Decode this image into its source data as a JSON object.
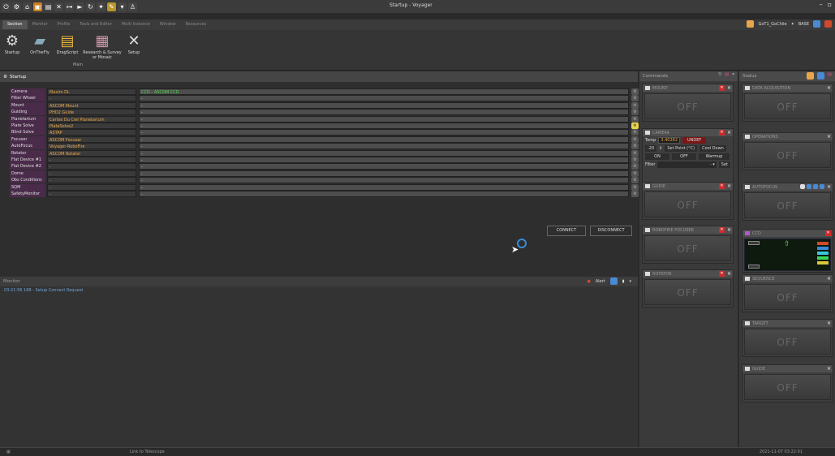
{
  "window": {
    "title": "Startup - Voyager"
  },
  "menu": {
    "tabs": [
      "Section",
      "Monitor",
      "Profile",
      "Tools and Editor",
      "Multi Instance",
      "Window",
      "Resources"
    ]
  },
  "user": {
    "profile": "GoT1_GoChile",
    "mode": "BASE"
  },
  "ribbon": {
    "buttons": [
      "Startup",
      "OnTheFly",
      "DragScript",
      "Research & Survey or Mosaic",
      "Setup"
    ],
    "group_label": "Main"
  },
  "startup": {
    "title": "Startup",
    "rows": [
      {
        "label": "Camera",
        "driver": "Maxim DL",
        "setting": "CCD - ASCOM CCD"
      },
      {
        "label": "Filter Wheel",
        "driver": "-",
        "setting": "-"
      },
      {
        "label": "Mount",
        "driver": "ASCOM Mount",
        "setting": "-"
      },
      {
        "label": "Guiding",
        "driver": "PHD2 Guide",
        "setting": "-"
      },
      {
        "label": "Planetarium",
        "driver": "Cartes Du Ciel Planetarium",
        "setting": "-"
      },
      {
        "label": "Plate Solve",
        "driver": "PlateSolve2",
        "setting": "-"
      },
      {
        "label": "Blind Solve",
        "driver": "ASTAP",
        "setting": "-"
      },
      {
        "label": "Focuser",
        "driver": "ASCOM Focuser",
        "setting": "-"
      },
      {
        "label": "AutoFocus",
        "driver": "Voyager RoboFire",
        "setting": "-"
      },
      {
        "label": "Rotator",
        "driver": "ASCOM Rotator",
        "setting": "-"
      },
      {
        "label": "Flat Device #1",
        "driver": "-",
        "setting": "-"
      },
      {
        "label": "Flat Device #2",
        "driver": "-",
        "setting": "-"
      },
      {
        "label": "Dome",
        "driver": "-",
        "setting": "-"
      },
      {
        "label": "Obs Conditions",
        "driver": "-",
        "setting": "-"
      },
      {
        "label": "SQM",
        "driver": "-",
        "setting": "-"
      },
      {
        "label": "SafetyMonitor",
        "driver": "-",
        "setting": "-"
      }
    ],
    "connect_label": "CONNECT",
    "disconnect_label": "DISCONNECT"
  },
  "monitor": {
    "title": "Monitor",
    "alert_label": "Alert",
    "log": [
      {
        "time": "03:21:56 168",
        "text": "Setup Connect Request"
      }
    ]
  },
  "commands": {
    "title": "Commands",
    "cards": [
      {
        "title": "MOUNT",
        "state": "OFF"
      },
      {
        "title": "CAMERA",
        "temp_label": "Temp",
        "temp_value": "3.40282",
        "temp_status": "UNDEF",
        "setpoint_value": "-20",
        "setpoint_label": "Set Point (°C)",
        "cooldown_label": "Cool Down",
        "on_label": "ON",
        "off_label": "OFF",
        "warmup_label": "Warmup",
        "filter_label": "Filter",
        "filter_value": "-",
        "set_label": "Set"
      },
      {
        "title": "GUIDE",
        "state": "OFF"
      },
      {
        "title": "ROBOFIRE FOCUSER",
        "state": "OFF"
      },
      {
        "title": "ROTATOR",
        "state": "OFF"
      }
    ]
  },
  "status": {
    "title": "Status",
    "cards": [
      {
        "title": "DATA ACQUISITION",
        "state": "OFF"
      },
      {
        "title": "OPERATIONS",
        "state": "OFF"
      },
      {
        "title": "AUTOFOCUS",
        "state": "OFF"
      },
      {
        "title": "CCD",
        "state": ""
      },
      {
        "title": "SEQUENCE",
        "state": "OFF"
      },
      {
        "title": "TARGET",
        "state": "OFF"
      },
      {
        "title": "GUIDE",
        "state": "OFF"
      }
    ]
  },
  "statusbar": {
    "left": "",
    "link": "Link to Telescope",
    "datetime": "2021-11-07  03:22:01"
  },
  "colors": {
    "accent": "#e8a64a",
    "label_bg": "#4a2b4a",
    "close_red": "#d02a2a",
    "log_blue": "#6fa8dc",
    "ok_green": "#5ed35e"
  }
}
